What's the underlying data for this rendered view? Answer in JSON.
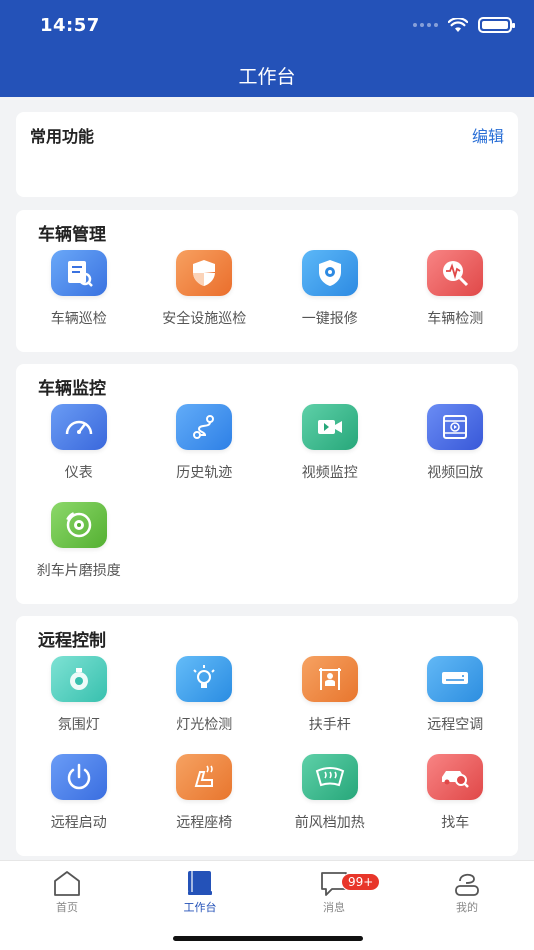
{
  "status_bar": {
    "time": "14:57"
  },
  "header": {
    "title": "工作台"
  },
  "common": {
    "title": "常用功能",
    "edit": "编辑"
  },
  "sections": [
    {
      "title": "车辆管理",
      "items": [
        {
          "label": "车辆巡检",
          "icon": "inspection-report-icon",
          "color": "#4a8df0"
        },
        {
          "label": "安全设施巡检",
          "icon": "shield-icon",
          "color": "#f0803c"
        },
        {
          "label": "一键报修",
          "icon": "repair-gear-shield-icon",
          "color": "#3a9de8"
        },
        {
          "label": "车辆检测",
          "icon": "heartbeat-search-icon",
          "color": "#ee5e5e"
        }
      ]
    },
    {
      "title": "车辆监控",
      "items": [
        {
          "label": "仪表",
          "icon": "speedometer-icon",
          "color": "#4a80e8"
        },
        {
          "label": "历史轨迹",
          "icon": "route-track-icon",
          "color": "#3d8fec"
        },
        {
          "label": "视频监控",
          "icon": "video-camera-icon",
          "color": "#36b98e"
        },
        {
          "label": "视频回放",
          "icon": "video-playback-icon",
          "color": "#4a70e6"
        },
        {
          "label": "刹车片磨损度",
          "icon": "brake-disc-icon",
          "color": "#6cc24a"
        }
      ]
    },
    {
      "title": "远程控制",
      "items": [
        {
          "label": "氛围灯",
          "icon": "ambient-light-icon",
          "color": "#4bd0c0"
        },
        {
          "label": "灯光检测",
          "icon": "light-bulb-icon",
          "color": "#3aa0ee"
        },
        {
          "label": "扶手杆",
          "icon": "handrail-icon",
          "color": "#ef8a3c"
        },
        {
          "label": "远程空调",
          "icon": "air-conditioner-icon",
          "color": "#3aa6e8"
        },
        {
          "label": "远程启动",
          "icon": "power-icon",
          "color": "#4a86ee"
        },
        {
          "label": "远程座椅",
          "icon": "seat-heat-icon",
          "color": "#f0843c"
        },
        {
          "label": "前风档加热",
          "icon": "windshield-heat-icon",
          "color": "#34b88a"
        },
        {
          "label": "找车",
          "icon": "car-search-icon",
          "color": "#ee5e5e"
        }
      ]
    }
  ],
  "bottom_nav": [
    {
      "label": "首页",
      "icon": "home-icon",
      "active": false
    },
    {
      "label": "工作台",
      "icon": "workbench-book-icon",
      "active": true
    },
    {
      "label": "消息",
      "icon": "message-icon",
      "active": false,
      "badge": "99+"
    },
    {
      "label": "我的",
      "icon": "profile-icon",
      "active": false
    }
  ],
  "colors": {
    "header_bg": "#2452b8",
    "accent": "#2a6fd6",
    "badge": "#e8362a"
  }
}
